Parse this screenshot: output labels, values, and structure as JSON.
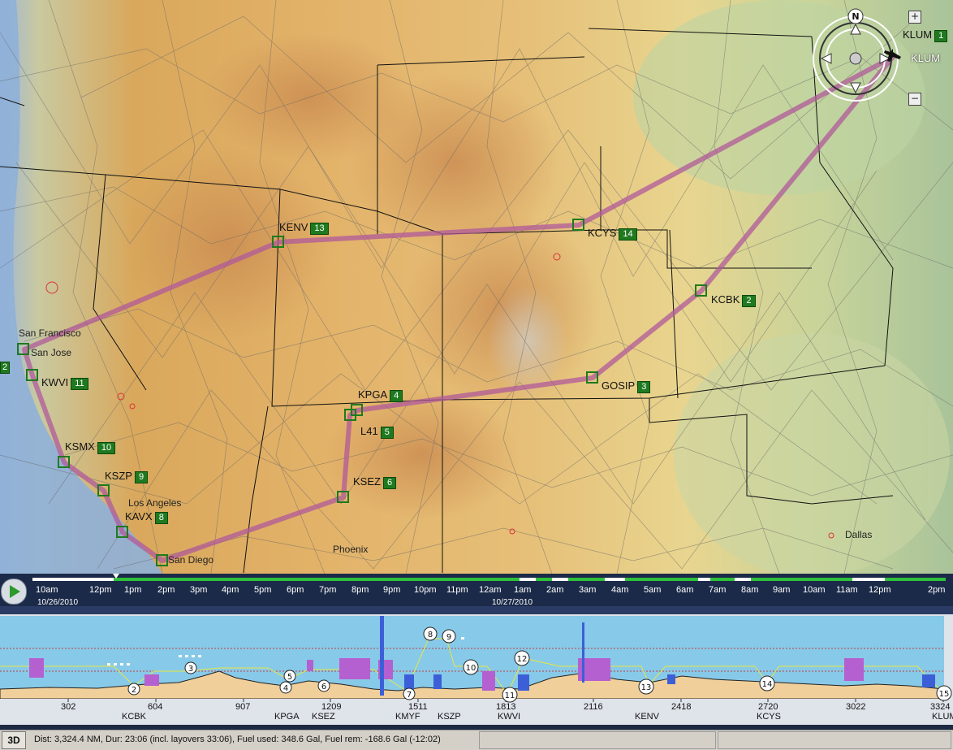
{
  "map": {
    "waypoints": [
      {
        "id": "kcbk",
        "code": "KCBK",
        "num": "2"
      },
      {
        "id": "gosip",
        "code": "GOSIP",
        "num": "3"
      },
      {
        "id": "kpga",
        "code": "KPGA",
        "num": "4"
      },
      {
        "id": "l41",
        "code": "L41",
        "num": "5"
      },
      {
        "id": "ksez",
        "code": "KSEZ",
        "num": "6"
      },
      {
        "id": "kavx",
        "code": "KAVX",
        "num": "8"
      },
      {
        "id": "kszp",
        "code": "KSZP",
        "num": "9"
      },
      {
        "id": "ksmx",
        "code": "KSMX",
        "num": "10"
      },
      {
        "id": "kwvi",
        "code": "KWVI",
        "num": "11"
      },
      {
        "id": "kenv",
        "code": "KENV",
        "num": "13"
      },
      {
        "id": "kcys",
        "code": "KCYS",
        "num": "14"
      },
      {
        "id": "klum1",
        "code": "KLUM",
        "num": "1"
      },
      {
        "id": "klum2",
        "code": "KLUM",
        "num": ""
      },
      {
        "id": "edge",
        "code": "",
        "num": "2"
      }
    ],
    "cities": {
      "san_francisco": "San Francisco",
      "san_jose": "San Jose",
      "los_angeles": "Los Angeles",
      "san_diego": "San Diego",
      "phoenix": "Phoenix",
      "dallas": "Dallas"
    },
    "compass_label": "N",
    "zoom_in": "+",
    "zoom_out": "−",
    "route_color": "#b05a9a",
    "marker_color": "#1f7a1f"
  },
  "timeline": {
    "times": [
      "10am",
      "12pm",
      "1pm",
      "2pm",
      "3pm",
      "4pm",
      "5pm",
      "6pm",
      "7pm",
      "8pm",
      "9pm",
      "10pm",
      "11pm",
      "12am",
      "1am",
      "2am",
      "3am",
      "4am",
      "5am",
      "6am",
      "7am",
      "8am",
      "9am",
      "10am",
      "11am",
      "12pm",
      "2pm"
    ],
    "dates": [
      "10/26/2010",
      "10/27/2010"
    ]
  },
  "profile": {
    "distances": [
      "302",
      "604",
      "907",
      "1209",
      "1511",
      "1813",
      "2116",
      "2418",
      "2720",
      "3022",
      "3324"
    ],
    "labels": [
      "KCBK",
      "KPGA",
      "KSEZ",
      "KMYF",
      "KSZP",
      "KWVI",
      "KENV",
      "KCYS",
      "KLUM"
    ],
    "leg_markers": [
      "2",
      "3",
      "4",
      "5",
      "6",
      "7",
      "8",
      "9",
      "10",
      "11",
      "12",
      "13",
      "14",
      "15"
    ]
  },
  "status": {
    "view_button": "3D",
    "summary": "Dist: 3,324.4 NM, Dur: 23:06 (incl. layovers 33:06), Fuel used: 348.6 Gal, Fuel rem: -168.6 Gal (-12:02)"
  }
}
